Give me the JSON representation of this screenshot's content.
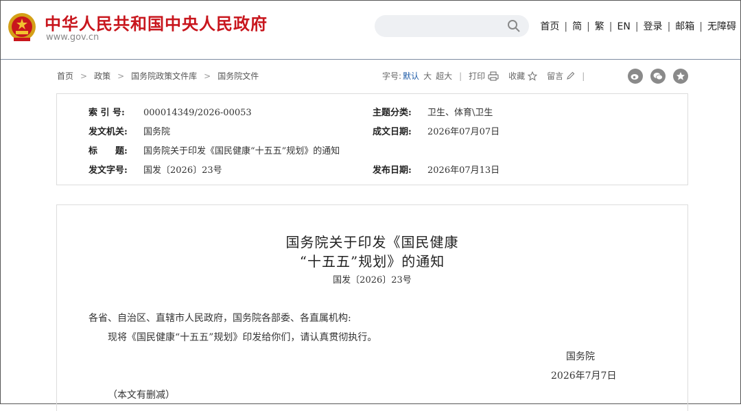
{
  "header": {
    "site_title": "中华人民共和国中央人民政府",
    "site_url": "www.gov.cn",
    "search": {
      "placeholder": ""
    },
    "nav": [
      "首页",
      "简",
      "繁",
      "EN",
      "登录",
      "邮箱",
      "无障碍"
    ]
  },
  "breadcrumb": [
    "首页",
    "政策",
    "国务院政策文件库",
    "国务院文件"
  ],
  "toolbar": {
    "font_size_label": "字号:",
    "font_sizes": [
      "默认",
      "大",
      "超大"
    ],
    "print_label": "打印",
    "favorite_label": "收藏",
    "comment_label": "留言"
  },
  "meta": {
    "index_label": "索 引 号:",
    "index_value": "000014349/2026-00053",
    "category_label": "主题分类:",
    "category_value": "卫生、体育\\卫生",
    "issuer_label": "发文机关:",
    "issuer_value": "国务院",
    "written_date_label": "成文日期:",
    "written_date_value": "2026年07月07日",
    "title_label": "标　　题:",
    "title_value": "国务院关于印发《国民健康“十五五”规划》的通知",
    "doc_number_label": "发文字号:",
    "doc_number_value": "国发〔2026〕23号",
    "publish_date_label": "发布日期:",
    "publish_date_value": "2026年07月13日"
  },
  "document": {
    "title_line1": "国务院关于印发《国民健康",
    "title_line2": "“十五五”规划》的通知",
    "number": "国发〔2026〕23号",
    "salutation": "各省、自治区、直辖市人民政府，国务院各部委、各直属机构:",
    "body": "现将《国民健康“十五五”规划》印发给你们，请认真贯彻执行。",
    "signature": "国务院",
    "date": "2026年7月7日",
    "note": "（本文有删减）"
  }
}
